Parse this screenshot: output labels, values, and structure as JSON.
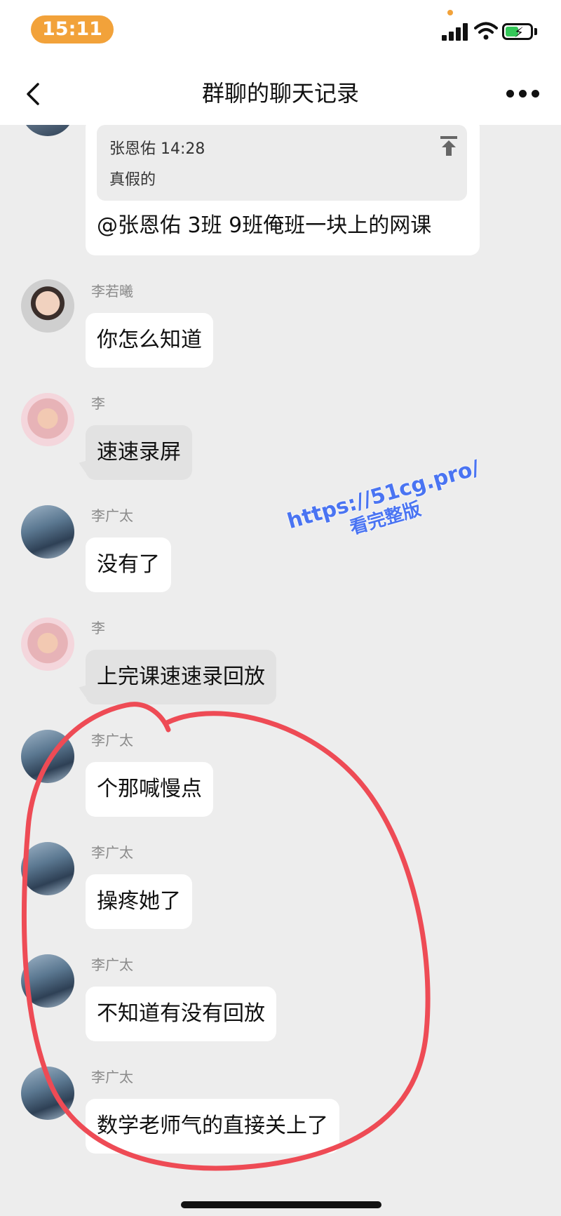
{
  "status_bar": {
    "time": "15:11"
  },
  "header": {
    "title": "群聊的聊天记录"
  },
  "quote_message": {
    "quote_author_time": "张恩佑 14:28",
    "quote_text": "真假的",
    "text": "@张恩佑 3班 9班俺班一块上的网课"
  },
  "messages": [
    {
      "sender": "李若曦",
      "text": "你怎么知道"
    },
    {
      "sender": "李",
      "text": "速速录屏"
    },
    {
      "sender": "李广太",
      "text": "没有了"
    },
    {
      "sender": "李",
      "text": "上完课速速录回放"
    },
    {
      "sender": "李广太",
      "text": "个那喊慢点"
    },
    {
      "sender": "李广太",
      "text": "操疼她了"
    },
    {
      "sender": "李广太",
      "text": "不知道有没有回放"
    },
    {
      "sender": "李广太",
      "text": "数学老师气的直接关上了"
    }
  ],
  "watermark": {
    "line1": "https://51cg.pro/",
    "line2": "看完整版"
  },
  "colors": {
    "time_pill": "#f2a23a",
    "annotation": "#ee4b55",
    "watermark": "#4a74f2",
    "battery": "#35c759"
  }
}
